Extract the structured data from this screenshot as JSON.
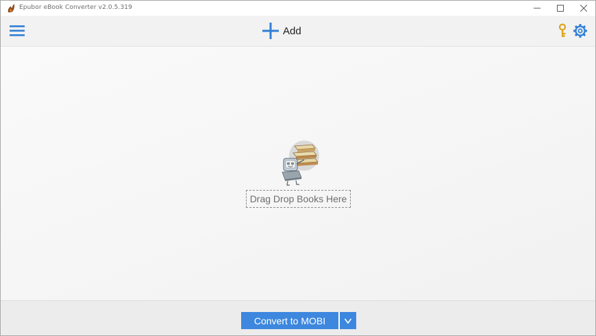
{
  "window": {
    "title": "Epubor eBook Converter v2.0.5.319"
  },
  "toolbar": {
    "add_label": "Add"
  },
  "drop_zone": {
    "label": "Drag Drop Books Here"
  },
  "bottom": {
    "convert_label": "Convert to MOBI"
  },
  "colors": {
    "accent": "#3d87de",
    "key": "#e0a41c"
  },
  "icons": {
    "menu": "hamburger-menu-icon",
    "add": "plus-icon",
    "key": "key-icon",
    "settings": "gear-icon",
    "dropdown": "chevron-down-icon"
  }
}
